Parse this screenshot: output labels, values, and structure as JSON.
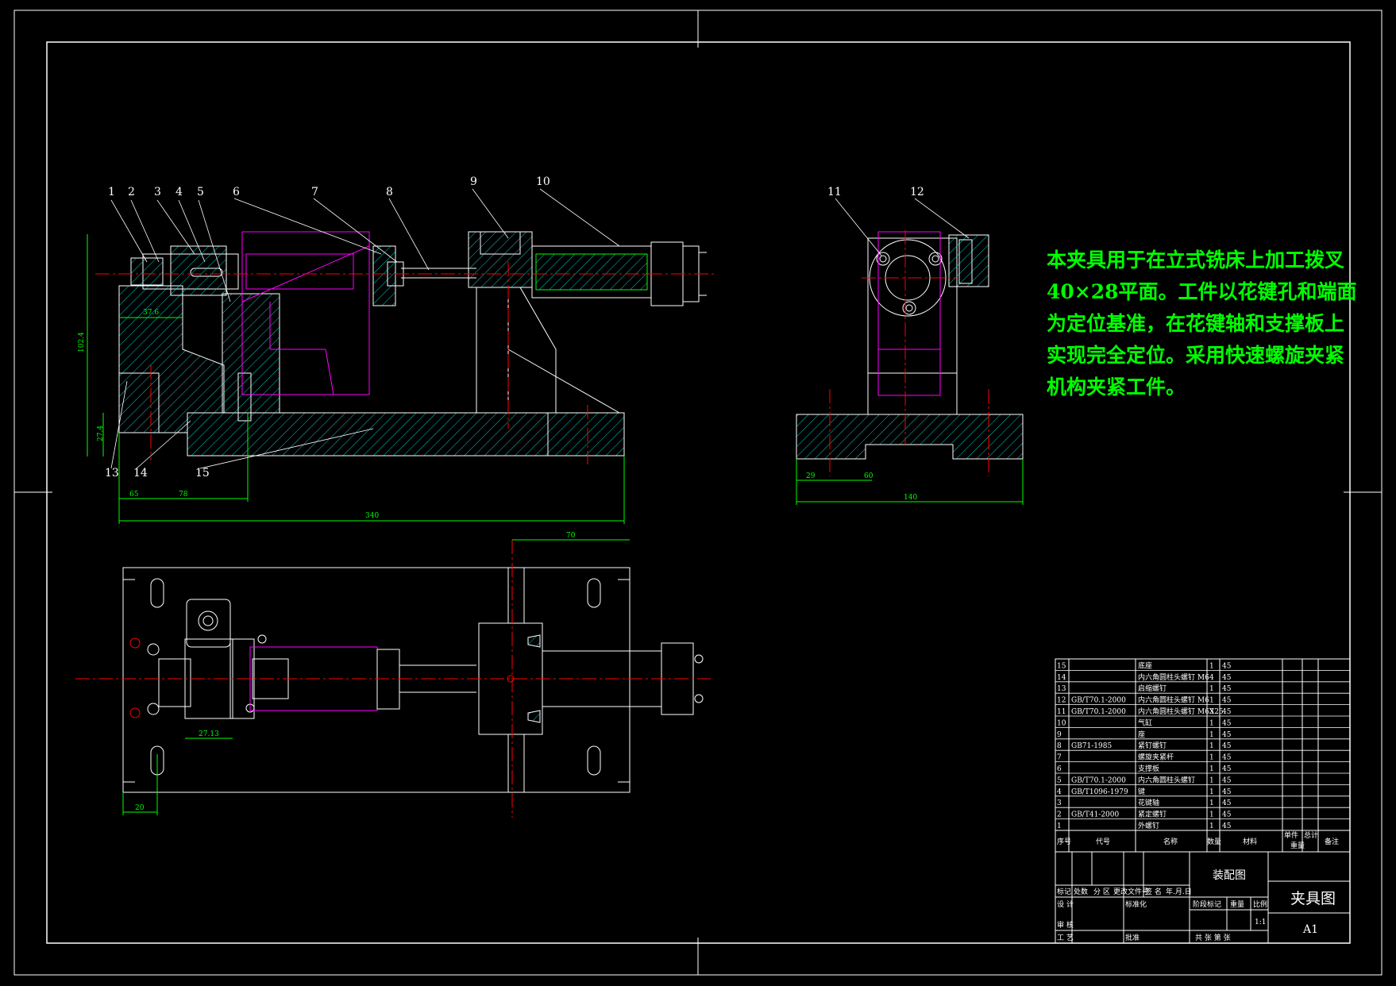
{
  "note": {
    "lines": [
      "本夹具用于在立式铣床上加工拨叉",
      "40×28平面。工件以花键孔和端面",
      "为定位基准，在花键轴和支撑板上",
      "实现完全定位。采用快速螺旋夹紧",
      "机构夹紧工件。"
    ]
  },
  "balloons": [
    "1",
    "2",
    "3",
    "4",
    "5",
    "6",
    "7",
    "8",
    "9",
    "10",
    "11",
    "12",
    "13",
    "14",
    "15"
  ],
  "dimensions": {
    "front_height": "102.4",
    "front_sub": "27.4",
    "front_top": "37.6",
    "front_a": "65",
    "front_b": "78",
    "front_total": "340",
    "side_a": "29",
    "side_b": "60",
    "side_total": "140",
    "plan_top": "70",
    "plan_mid": "27.13",
    "plan_left": "20"
  },
  "bom": {
    "rows": [
      {
        "no": "15",
        "code": "",
        "name": "底座",
        "qty": "1",
        "mat": "45"
      },
      {
        "no": "14",
        "code": "",
        "name": "内六角圆柱头螺钉 M6",
        "qty": "4",
        "mat": "45"
      },
      {
        "no": "13",
        "code": "",
        "name": "启缩螺钉",
        "qty": "1",
        "mat": "45"
      },
      {
        "no": "12",
        "code": "GB/T70.1-2000",
        "name": "内六角圆柱头螺钉 M6",
        "qty": "1",
        "mat": "45"
      },
      {
        "no": "11",
        "code": "GB/T70.1-2000",
        "name": "内六角圆柱头螺钉 M6X25",
        "qty": "3",
        "mat": "45"
      },
      {
        "no": "10",
        "code": "",
        "name": "气缸",
        "qty": "1",
        "mat": "45"
      },
      {
        "no": "9",
        "code": "",
        "name": "座",
        "qty": "1",
        "mat": "45"
      },
      {
        "no": "8",
        "code": "GB71-1985",
        "name": "紧钉螺钉",
        "qty": "1",
        "mat": "45"
      },
      {
        "no": "7",
        "code": "",
        "name": "螺旋夹紧杆",
        "qty": "1",
        "mat": "45"
      },
      {
        "no": "6",
        "code": "",
        "name": "支撑板",
        "qty": "1",
        "mat": "45"
      },
      {
        "no": "5",
        "code": "GB/T70.1-2000",
        "name": "内六角圆柱头螺钉",
        "qty": "1",
        "mat": "45"
      },
      {
        "no": "4",
        "code": "GB/T1096-1979",
        "name": "键",
        "qty": "1",
        "mat": "45"
      },
      {
        "no": "3",
        "code": "",
        "name": "花键轴",
        "qty": "1",
        "mat": "45"
      },
      {
        "no": "2",
        "code": "GB/T41-2000",
        "name": "紧定螺钉",
        "qty": "1",
        "mat": "45"
      },
      {
        "no": "1",
        "code": "",
        "name": "外螺钉",
        "qty": "1",
        "mat": "45"
      }
    ],
    "header": {
      "no": "序号",
      "code": "代号",
      "name": "名称",
      "qty": "数量",
      "mat": "材料",
      "unit": "单件",
      "total": "总计",
      "weight": "重量",
      "remark": "备注"
    }
  },
  "title_block": {
    "drawing_type": "装配图",
    "drawing_name": "夹具图",
    "sheet_size": "A1",
    "scale": "1:1",
    "labels": {
      "mark": "标记",
      "count": "处数",
      "zone": "分 区",
      "change": "更改文件号",
      "sign": "签 名",
      "date": "年.月.日",
      "design": "设 计",
      "standard": "标准化",
      "stage": "阶段标记",
      "weight": "重量",
      "ratio": "比例",
      "check": "审 核",
      "process": "工 艺",
      "approve": "批准",
      "sheets": "共   张   第   张"
    }
  },
  "colors": {
    "bg": "#000000",
    "line": "#ffffff",
    "center": "#ff0000",
    "hatch": "#00cccc",
    "dim": "#00ff00",
    "magenta": "#ff00ff",
    "note": "#00ff00"
  }
}
